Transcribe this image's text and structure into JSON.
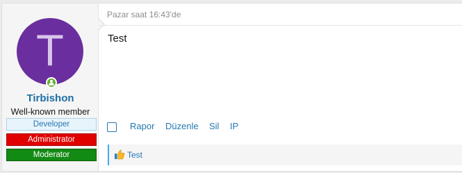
{
  "post": {
    "timestamp": "Pazar saat 16:43'de",
    "message": "Test"
  },
  "user": {
    "avatar_letter": "T",
    "avatar_color": "#6a2e9e",
    "username": "Tirbishon",
    "user_title": "Well-known member",
    "online_status": "online",
    "banners": [
      {
        "label": "Developer",
        "color": "#2577b1"
      },
      {
        "label": "Administrator",
        "color": "#e00000"
      },
      {
        "label": "Moderator",
        "color": "#138a14"
      }
    ]
  },
  "actions": {
    "report": "Rapor",
    "edit": "Düzenle",
    "delete": "Sil",
    "ip": "IP"
  },
  "reactions": {
    "icon": "thumbs-up-icon",
    "text": "Test"
  }
}
